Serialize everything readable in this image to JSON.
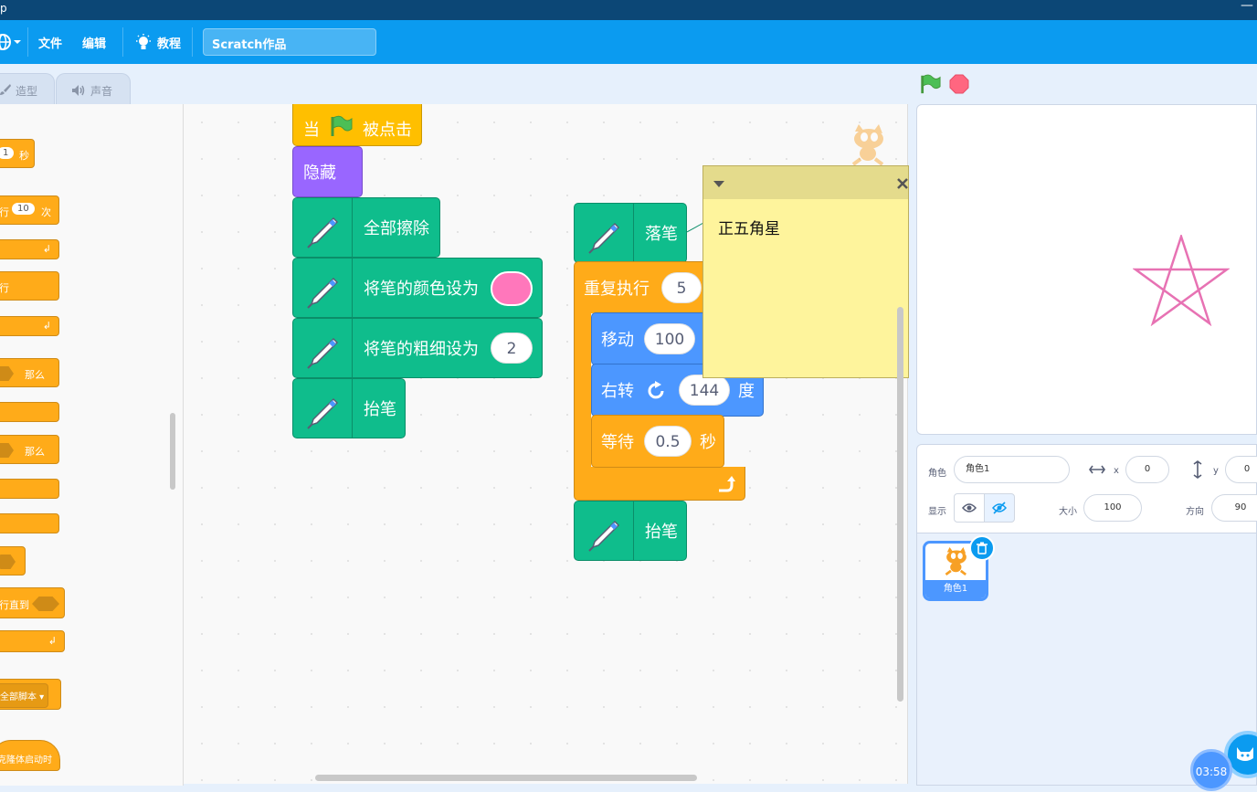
{
  "window": {
    "title": "p",
    "minimize": "—"
  },
  "menubar": {
    "file": "文件",
    "edit": "编辑",
    "tutorial": "教程",
    "project_title": "Scratch作品"
  },
  "tabs": {
    "costumes": "造型",
    "sounds": "声音"
  },
  "palette": {
    "wait_secs": "1",
    "wait_unit": "秒",
    "repeat_prefix": "行",
    "repeat_count": "10",
    "repeat_unit": "次",
    "forever_label": "行",
    "if_then": "那么",
    "if_else_then": "那么",
    "repeat_until": "行直到",
    "stop_all": "全部脚本",
    "clone_start": "克隆体启动时"
  },
  "script1": {
    "when": "当",
    "clicked": "被点击",
    "hide": "隐藏",
    "clear": "全部擦除",
    "set_color": "将笔的颜色设为",
    "set_size": "将笔的粗细设为",
    "size_value": "2",
    "pen_up": "抬笔",
    "pen_color": "#ff77bb"
  },
  "script2": {
    "pen_down": "落笔",
    "repeat": "重复执行",
    "repeat_count": "5",
    "move": "移动",
    "move_steps": "100",
    "turn": "右转",
    "turn_degrees": "144",
    "degree_unit": "度",
    "wait": "等待",
    "wait_secs": "0.5",
    "wait_unit": "秒",
    "pen_up": "抬笔"
  },
  "comment": {
    "text": "正五角星"
  },
  "zoom": {
    "reset": "="
  },
  "sprite_info": {
    "sprite_label": "角色",
    "sprite_name": "角色1",
    "x_label": "x",
    "x_value": "0",
    "y_label": "y",
    "y_value": "0",
    "show_label": "显示",
    "size_label": "大小",
    "size_value": "100",
    "direction_label": "方向",
    "direction_value": "90"
  },
  "sprites": [
    {
      "name": "角色1"
    }
  ],
  "timer": "03:58",
  "colors": {
    "menubar": "#0b9bf0",
    "events": "#ffbf00",
    "looks": "#9966ff",
    "pen": "#0fbd8c",
    "motion": "#4c97ff",
    "control": "#ffab19",
    "star_stroke": "#e772b3"
  }
}
